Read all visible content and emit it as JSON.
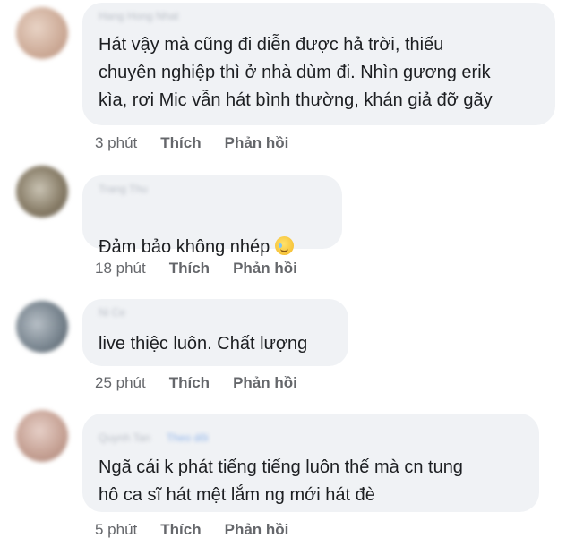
{
  "comments": [
    {
      "author": "Hang Hong Nhat",
      "text": "Hát vậy mà cũng đi diễn được hả trời, thiếu\nchuyên nghiệp thì ở nhà dùm đi. Nhìn gương erik\nkìa, rơi Mic vẫn hát bình thường, khán giả đỡ gãy",
      "time": "3 phút",
      "like": "Thích",
      "reply": "Phản hồi"
    },
    {
      "author": "Trang Thu",
      "text": "Đảm bảo không nhép",
      "time": "18 phút",
      "like": "Thích",
      "reply": "Phản hồi"
    },
    {
      "author": "Ni Ce",
      "text": "live thiệc luôn. Chất lượng",
      "time": "25 phút",
      "like": "Thích",
      "reply": "Phản hồi"
    },
    {
      "author": "Quynh Tan",
      "author_tag": "Theo dõi",
      "text": "Ngã cái k phát tiếng tiếng luôn thế mà cn tung\nhô ca sĩ hát mệt lắm ng mới hát đè",
      "time": "5 phút",
      "like": "Thích",
      "reply": "Phản hồi"
    }
  ],
  "icons": {
    "comment_2_emoji": "crying-smile-emoji-icon"
  },
  "colors": {
    "bubble_background": "#f0f2f5",
    "action_text": "#65676b",
    "comment_text": "#1c1e21"
  }
}
